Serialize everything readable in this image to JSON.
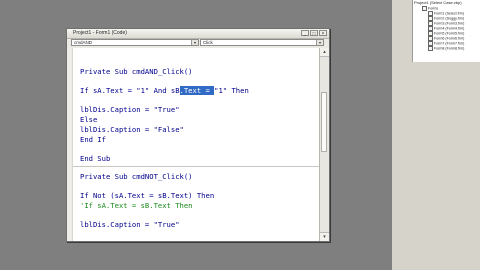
{
  "window": {
    "title": "Project1 - Form1 (Code)",
    "buttons": [
      "_",
      "□",
      "×"
    ]
  },
  "object_combo": {
    "value": "cmdAND"
  },
  "proc_combo": {
    "value": "Click"
  },
  "code_lines": [
    {
      "text": "Private Sub cmdAND_Click()"
    },
    {
      "text": "If sA.Text = \"1\" And sB.Text = \"1\" Then",
      "pre": "If sA.Text = \"1\" And sB",
      "sel": ".Text = ",
      "post": "\"1\" Then"
    },
    {
      "text": "lblDis.Caption = \"True\""
    },
    {
      "text": "Else"
    },
    {
      "text": "lblDis.Caption = \"False\""
    },
    {
      "text": "End If"
    },
    {
      "text": "End Sub"
    },
    {
      "text": "Private Sub cmdNOT_Click()"
    },
    {
      "text": "If Not (sA.Text = sB.Text) Then"
    },
    {
      "text": "'If sA.Text = sB.Text Then"
    },
    {
      "text": "lblDis.Caption = \"True\""
    }
  ],
  "project_panel": {
    "title": "Project1 (Select Case.vbp)",
    "folder": "Forms",
    "items": [
      "Form1 (Select.frm)",
      "Form2 (Doggy.frm)",
      "Form3 (Form3.frm)",
      "Form4 (Form4.frm)",
      "Form5 (Form5.frm)",
      "Form6 (Form6.frm)",
      "Form7 (Form7.frm)",
      "Form8 (Form8.frm)"
    ]
  },
  "colors": {
    "keyword": "#00008b",
    "comment": "#1a8a1a",
    "selection": "#316ac5"
  }
}
